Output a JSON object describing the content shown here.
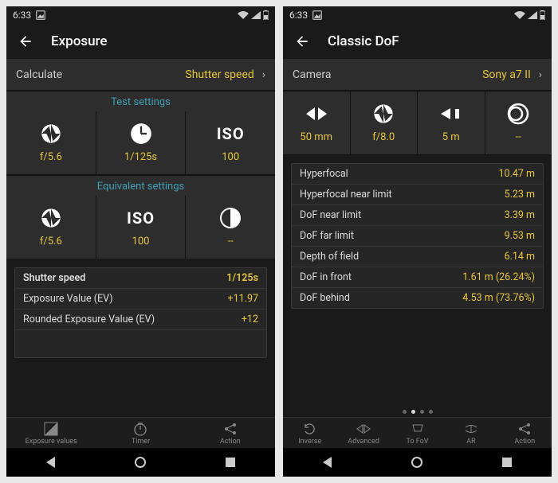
{
  "status": {
    "time": "6:33"
  },
  "left": {
    "title": "Exposure",
    "calcLabel": "Calculate",
    "calcValue": "Shutter speed",
    "section1": "Test settings",
    "tiles1": {
      "aperture": "f/5.6",
      "shutter": "1/125s",
      "iso": "100"
    },
    "section2": "Equivalent settings",
    "tiles2": {
      "aperture": "f/5.6",
      "iso": "100",
      "nd": "--"
    },
    "results": {
      "headLabel": "Shutter speed",
      "headVal": "1/125s",
      "r1l": "Exposure Value (EV)",
      "r1v": "+11.97",
      "r2l": "Rounded Exposure Value (EV)",
      "r2v": "+12"
    },
    "tabs": {
      "t1": "Exposure values",
      "t2": "Timer",
      "t3": "Action"
    }
  },
  "right": {
    "title": "Classic DoF",
    "camLabel": "Camera",
    "camValue": "Sony a7 II",
    "tiles": {
      "focal": "50 mm",
      "aperture": "f/8.0",
      "dist": "5 m",
      "coc": "--"
    },
    "results": {
      "r1l": "Hyperfocal",
      "r1v": "10.47 m",
      "r2l": "Hyperfocal near limit",
      "r2v": "5.23 m",
      "r3l": "DoF near limit",
      "r3v": "3.39 m",
      "r4l": "DoF far limit",
      "r4v": "9.53 m",
      "r5l": "Depth of field",
      "r5v": "6.14 m",
      "r6l": "DoF in front",
      "r6v": "1.61 m (26.24%)",
      "r7l": "DoF behind",
      "r7v": "4.53 m (73.76%)"
    },
    "tabs": {
      "t1": "Inverse",
      "t2": "Advanced",
      "t3": "To FoV",
      "t4": "AR",
      "t5": "Action"
    }
  }
}
